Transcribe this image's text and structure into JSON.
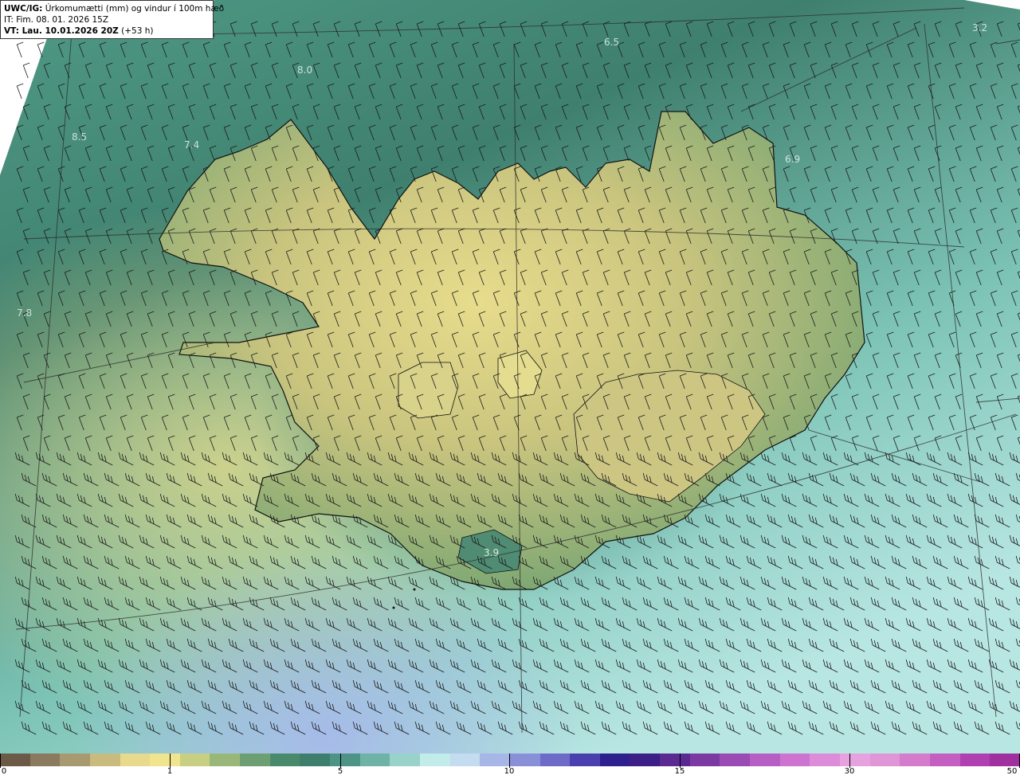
{
  "header": {
    "product": "UWC/IG:",
    "title": "Úrkomumætti (mm) og vindur í 100m hæð",
    "it_line": "IT: Fim. 08. 01. 2026 15Z",
    "vt_bold": "VT: Lau. 10.01.2026 20Z",
    "vt_offset": "(+53 h)"
  },
  "map_labels": [
    {
      "text": "6.5"
    },
    {
      "text": "3.2"
    },
    {
      "text": "8.0"
    },
    {
      "text": "7.4"
    },
    {
      "text": "8.5"
    },
    {
      "text": "6.9"
    },
    {
      "text": "7.8"
    },
    {
      "text": "3.9"
    }
  ],
  "colorbar": {
    "tick_labels": [
      "0",
      "1",
      "5",
      "10",
      "15",
      "30",
      "50"
    ],
    "colors": [
      "#6b5a48",
      "#8a7a5e",
      "#a89a70",
      "#c9bb7e",
      "#e8da8c",
      "#f0e48e",
      "#c8cf82",
      "#9ab77a",
      "#6e9f72",
      "#4a8a6c",
      "#3d7f6c",
      "#4d9486",
      "#6fb3a7",
      "#98d2c8",
      "#c2ecea",
      "#c3dcf0",
      "#a6b6e6",
      "#8a90d8",
      "#6e6ac8",
      "#4a3fae",
      "#2e1f8e",
      "#3b1f86",
      "#5a2a92",
      "#7a3aa2",
      "#9a4cb4",
      "#b65ec4",
      "#cc74cf",
      "#dc8cd8",
      "#e6a2de",
      "#e096d6",
      "#d47ccb",
      "#c45ec0",
      "#b040b2",
      "#a0309f"
    ]
  },
  "colors": {
    "sea_deep": "#3f7f6e",
    "sea_light": "#a9dcd6",
    "land_low": "#7aa876",
    "land_high": "#e6da8a",
    "coastline": "#111111",
    "grid": "#2b2b2b",
    "barb": "#1a1a1a"
  }
}
